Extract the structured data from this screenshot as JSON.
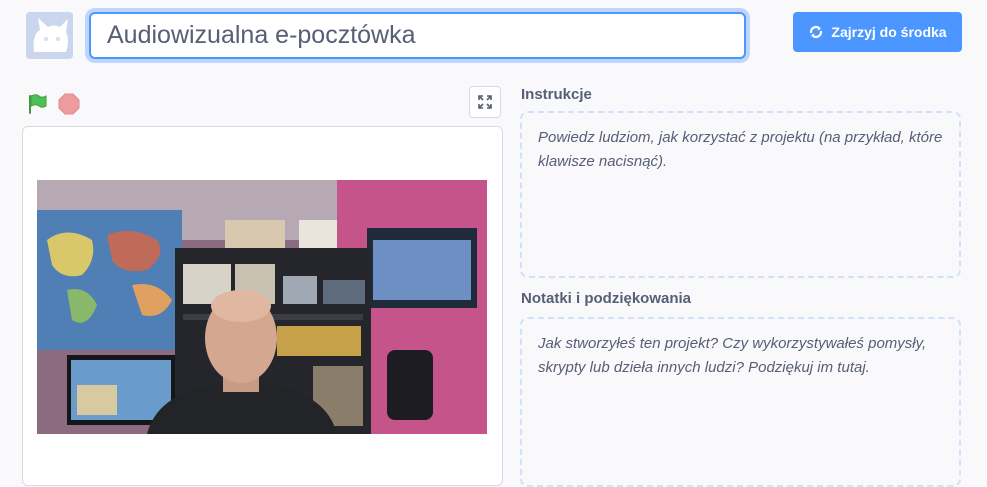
{
  "project": {
    "title": "Audiowizualna e-pocztówka",
    "see_inside_label": "Zajrzyj do środka"
  },
  "controls": {
    "green_flag_icon": "green-flag-icon",
    "stop_icon": "stop-sign-icon",
    "fullscreen_icon": "fullscreen-icon"
  },
  "instructions": {
    "label": "Instrukcje",
    "placeholder": "Powiedz ludziom, jak korzystać z projektu (na przykład, które klawisze nacisnąć)."
  },
  "notes": {
    "label": "Notatki i podziękowania",
    "placeholder": "Jak stworzyłeś ten projekt? Czy wykorzystywałeś pomysły, skrypty lub dzieła innych ludzi? Podziękuj im tutaj."
  },
  "colors": {
    "accent": "#4c97ff",
    "text": "#575e75",
    "flag": "#4cbf56",
    "stop": "#ec9c9c",
    "background": "#f9f9fb"
  }
}
